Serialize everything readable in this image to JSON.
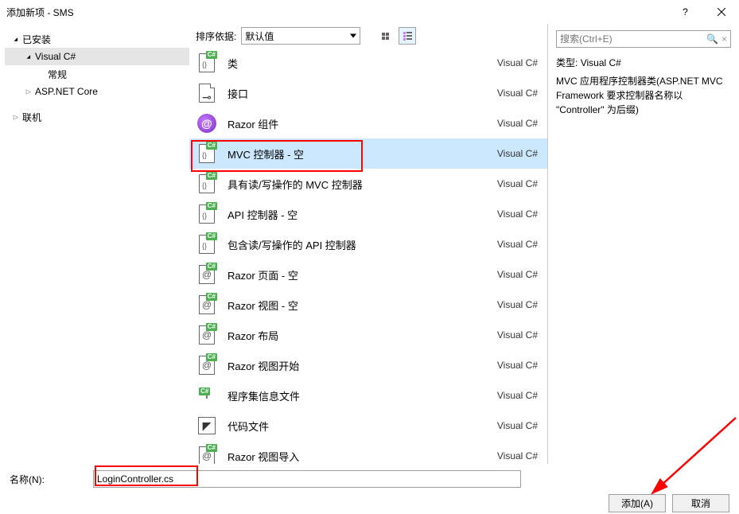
{
  "titlebar": {
    "title": "添加新项 - SMS"
  },
  "sidebar": {
    "installed": "已安装",
    "visual_cs": "Visual C#",
    "general": "常规",
    "aspnet_core": "ASP.NET Core",
    "online": "联机"
  },
  "toolbar": {
    "sort_label": "排序依据:",
    "sort_value": "默认值"
  },
  "items": [
    {
      "name": "类",
      "lang": "Visual C#",
      "icon": "cs"
    },
    {
      "name": "接口",
      "lang": "Visual C#",
      "icon": "interface"
    },
    {
      "name": "Razor 组件",
      "lang": "Visual C#",
      "icon": "razor"
    },
    {
      "name": "MVC 控制器 - 空",
      "lang": "Visual C#",
      "icon": "cs",
      "selected": true
    },
    {
      "name": "具有读/写操作的 MVC 控制器",
      "lang": "Visual C#",
      "icon": "cs"
    },
    {
      "name": "API 控制器 - 空",
      "lang": "Visual C#",
      "icon": "cs"
    },
    {
      "name": "包含读/写操作的 API 控制器",
      "lang": "Visual C#",
      "icon": "cs"
    },
    {
      "name": "Razor 页面 - 空",
      "lang": "Visual C#",
      "icon": "at"
    },
    {
      "name": "Razor 视图 - 空",
      "lang": "Visual C#",
      "icon": "at"
    },
    {
      "name": "Razor 布局",
      "lang": "Visual C#",
      "icon": "at"
    },
    {
      "name": "Razor 视图开始",
      "lang": "Visual C#",
      "icon": "at"
    },
    {
      "name": "程序集信息文件",
      "lang": "Visual C#",
      "icon": "info"
    },
    {
      "name": "代码文件",
      "lang": "Visual C#",
      "icon": "code"
    },
    {
      "name": "Razor 视图导入",
      "lang": "Visual C#",
      "icon": "at"
    }
  ],
  "rightPanel": {
    "search_placeholder": "搜索(Ctrl+E)",
    "type_label": "类型:",
    "type_value": "Visual C#",
    "description": "MVC 应用程序控制器类(ASP.NET MVC Framework 要求控制器名称以 \"Controller\" 为后缀)"
  },
  "footer": {
    "name_label": "名称(N):",
    "name_value": "LoginController.cs",
    "add_button": "添加(A)",
    "cancel_button": "取消"
  }
}
